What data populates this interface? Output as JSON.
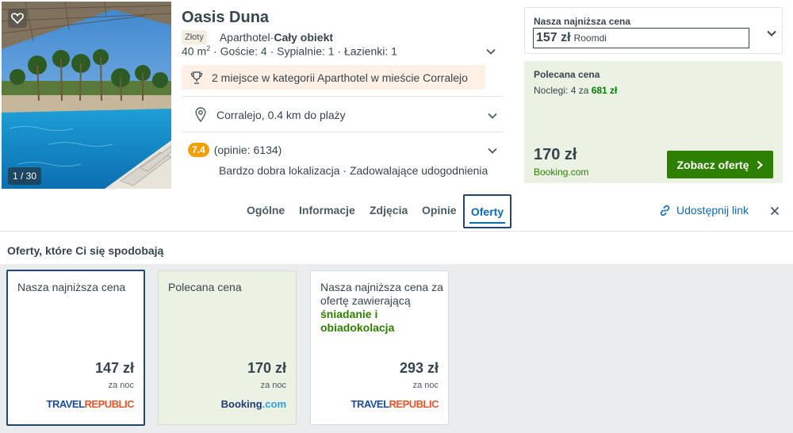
{
  "hotel": {
    "name": "Oasis Duna",
    "photo_counter": "1 / 30",
    "tag": "Złoty",
    "type": "Aparthotel",
    "type_sep": " · ",
    "scope": "Cały obiekt",
    "details_area": "40 m",
    "details_area_sup": "2",
    "details_rest": " · Goście: 4 · Sypialnie: 1 · Łazienki: 1",
    "award": "2 miejsce w kategorii Aparthotel w mieście Corralejo",
    "location": "Corralejo, 0.4 km do plaży",
    "score": "7.4",
    "reviews": "(opinie: 6134)",
    "rating_desc": "Bardzo dobra lokalizacja · Zadowalające udogodnienia"
  },
  "lowest_box": {
    "label": "Nasza najniższa cena",
    "price": "157 zł",
    "site": "Roomdi"
  },
  "recommended_box": {
    "title": "Polecana cena",
    "nights_prefix": "Noclegi: 4 za ",
    "nights_total": "681 zł",
    "price": "170 zł",
    "site": "Booking.com",
    "button": "Zobacz ofertę"
  },
  "tabs": {
    "general": "Ogólne",
    "info": "Informacje",
    "photos": "Zdjęcia",
    "reviews": "Opinie",
    "offers": "Oferty"
  },
  "share_label": "Udostępnij link",
  "offers_title": "Oferty, które Ci się spodobają",
  "cards": [
    {
      "title": "Nasza najniższa cena",
      "price": "147 zł",
      "unit": "za noc",
      "logo_a": "TRAVEL",
      "logo_b": "REPUBLIC"
    },
    {
      "title": "Polecana cena",
      "price": "170 zł",
      "unit": "za noc",
      "logo_a": "Booking",
      "logo_b": ".com"
    },
    {
      "title": "Nasza najniższa cena za ofertę zawierającą",
      "highlight": "śniadanie i obiadokolacja",
      "price": "293 zł",
      "unit": "za noc",
      "logo_a": "TRAVEL",
      "logo_b": "REPUBLIC"
    }
  ],
  "colors": {
    "accent_blue": "#0a6ab6",
    "green": "#2e8000",
    "score_orange": "#f39f00",
    "selection_border": "#23466e"
  },
  "icons": {
    "favorite": "heart-icon",
    "award": "trophy-icon",
    "location": "map-pin-icon",
    "share": "link-icon",
    "close": "close-icon",
    "expand": "chevron-down-icon",
    "button_arrow": "chevron-right-icon"
  }
}
